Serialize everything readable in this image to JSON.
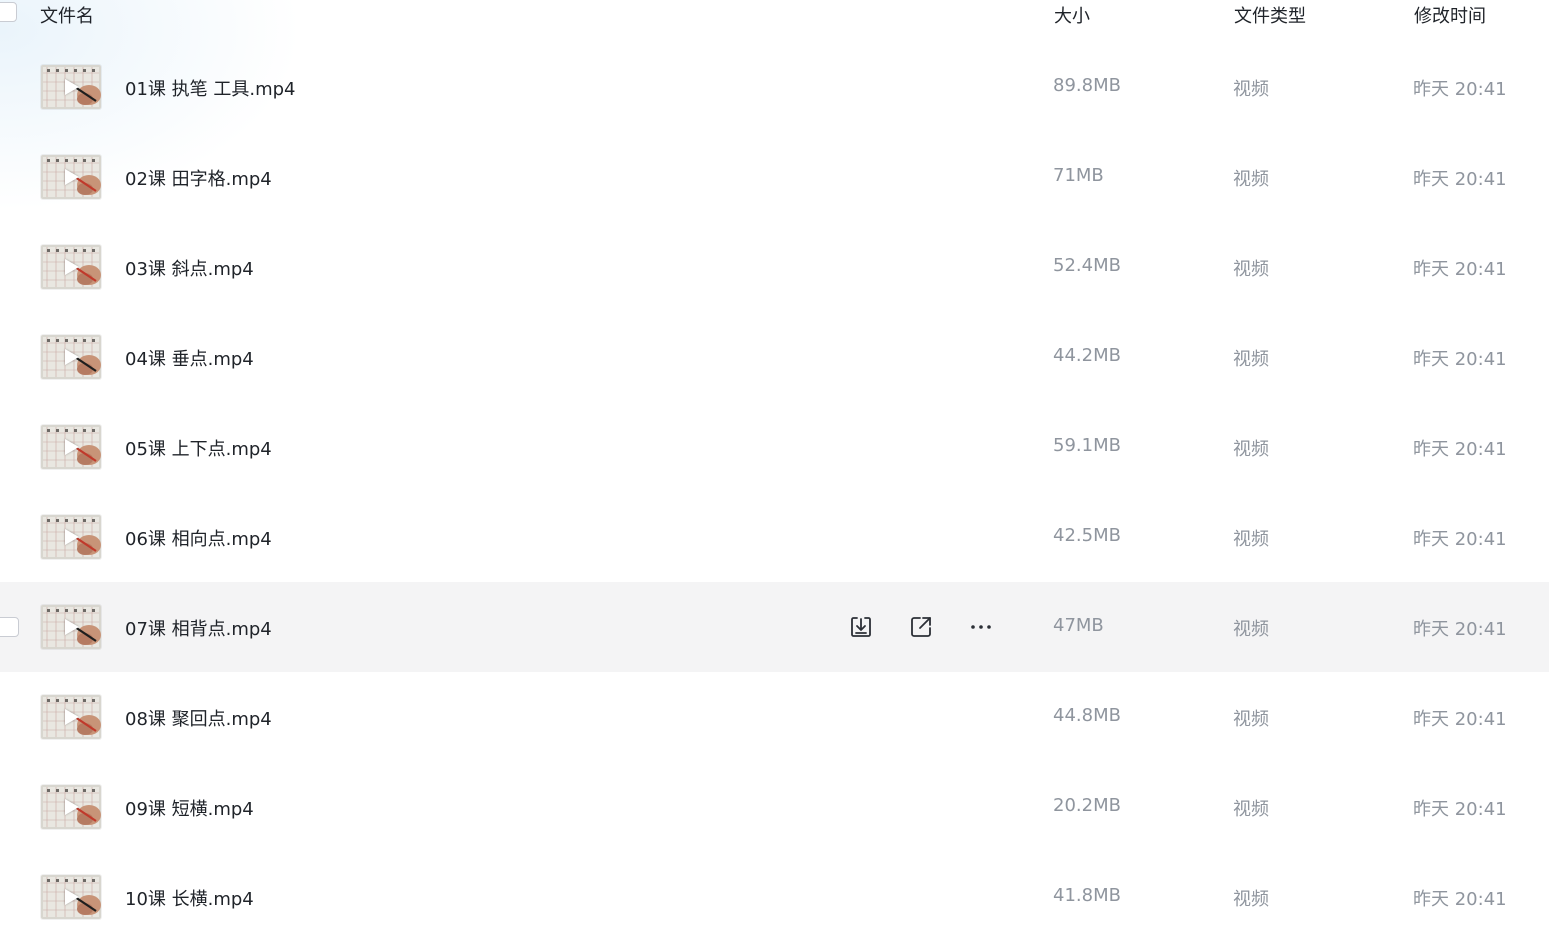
{
  "header": {
    "name_label": "文件名",
    "size_label": "大小",
    "type_label": "文件类型",
    "time_label": "修改时间"
  },
  "files": [
    {
      "name": "01课 执笔 工具.mp4",
      "size": "89.8MB",
      "type": "视频",
      "modified": "昨天 20:41"
    },
    {
      "name": "02课 田字格.mp4",
      "size": "71MB",
      "type": "视频",
      "modified": "昨天 20:41"
    },
    {
      "name": "03课 斜点.mp4",
      "size": "52.4MB",
      "type": "视频",
      "modified": "昨天 20:41"
    },
    {
      "name": "04课 垂点.mp4",
      "size": "44.2MB",
      "type": "视频",
      "modified": "昨天 20:41"
    },
    {
      "name": "05课 上下点.mp4",
      "size": "59.1MB",
      "type": "视频",
      "modified": "昨天 20:41"
    },
    {
      "name": "06课 相向点.mp4",
      "size": "42.5MB",
      "type": "视频",
      "modified": "昨天 20:41"
    },
    {
      "name": "07课 相背点.mp4",
      "size": "47MB",
      "type": "视频",
      "modified": "昨天 20:41"
    },
    {
      "name": "08课 聚回点.mp4",
      "size": "44.8MB",
      "type": "视频",
      "modified": "昨天 20:41"
    },
    {
      "name": "09课 短横.mp4",
      "size": "20.2MB",
      "type": "视频",
      "modified": "昨天 20:41"
    },
    {
      "name": "10课 长横.mp4",
      "size": "41.8MB",
      "type": "视频",
      "modified": "昨天 20:41"
    }
  ],
  "hovered_row_index": 6,
  "row_actions": [
    "download-icon",
    "share-icon",
    "more-icon"
  ],
  "colors": {
    "text_primary": "#1f2329",
    "text_secondary": "#8f959e",
    "hover_bg": "#f4f4f5",
    "icon": "#2b2f36"
  }
}
